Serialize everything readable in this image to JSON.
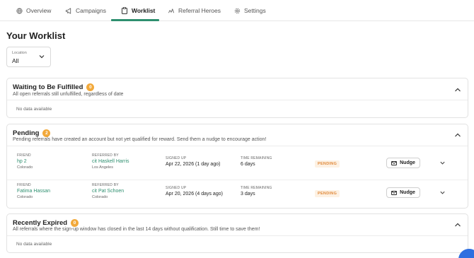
{
  "tabs": [
    {
      "label": "Overview",
      "icon": "globe-icon"
    },
    {
      "label": "Campaigns",
      "icon": "megaphone-icon"
    },
    {
      "label": "Worklist",
      "icon": "clipboard-icon"
    },
    {
      "label": "Referral Heroes",
      "icon": "heroes-icon"
    },
    {
      "label": "Settings",
      "icon": "gear-icon"
    }
  ],
  "active_tab": "Worklist",
  "page_title": "Your Worklist",
  "location": {
    "label": "Location",
    "value": "All"
  },
  "sections": {
    "waiting": {
      "title": "Waiting to Be Fulfilled",
      "count": "0",
      "subtitle": "All open referrals still unfulfilled, regardless of date",
      "empty": "No data available"
    },
    "pending": {
      "title": "Pending",
      "count": "2",
      "subtitle": "Pending referrals have created an account but not yet qualified for reward. Send them a nudge to encourage action!",
      "columns": {
        "friend": "FRIEND",
        "referred_by": "REFERRED BY",
        "signed_up": "SIGNED UP",
        "time_remaining": "TIME REMAINING"
      },
      "rows": [
        {
          "friend": "hp 2",
          "friend_location": "Colorado",
          "referred_by": "cit Haskell Harris",
          "referrer_location": "Los Angeles",
          "signed_up": "Apr 22, 2026 (1 day ago)",
          "time_remaining": "6 days",
          "status": "PENDING",
          "action": "Nudge"
        },
        {
          "friend": "Fatima Hassan",
          "friend_location": "Colorado",
          "referred_by": "cit Pat Schoen",
          "referrer_location": "Colorado",
          "signed_up": "Apr 20, 2026 (4 days ago)",
          "time_remaining": "3 days",
          "status": "PENDING",
          "action": "Nudge"
        }
      ]
    },
    "expired": {
      "title": "Recently Expired",
      "count": "0",
      "subtitle": "All referrals where the sign-up window has closed in the last 14 days without qualification. Still time to save them!",
      "empty": "No data available"
    }
  },
  "colors": {
    "accent": "#2e8f6f",
    "badge": "#f2a93b",
    "pending": "#e08a3c",
    "fab": "#2f6fe0"
  }
}
